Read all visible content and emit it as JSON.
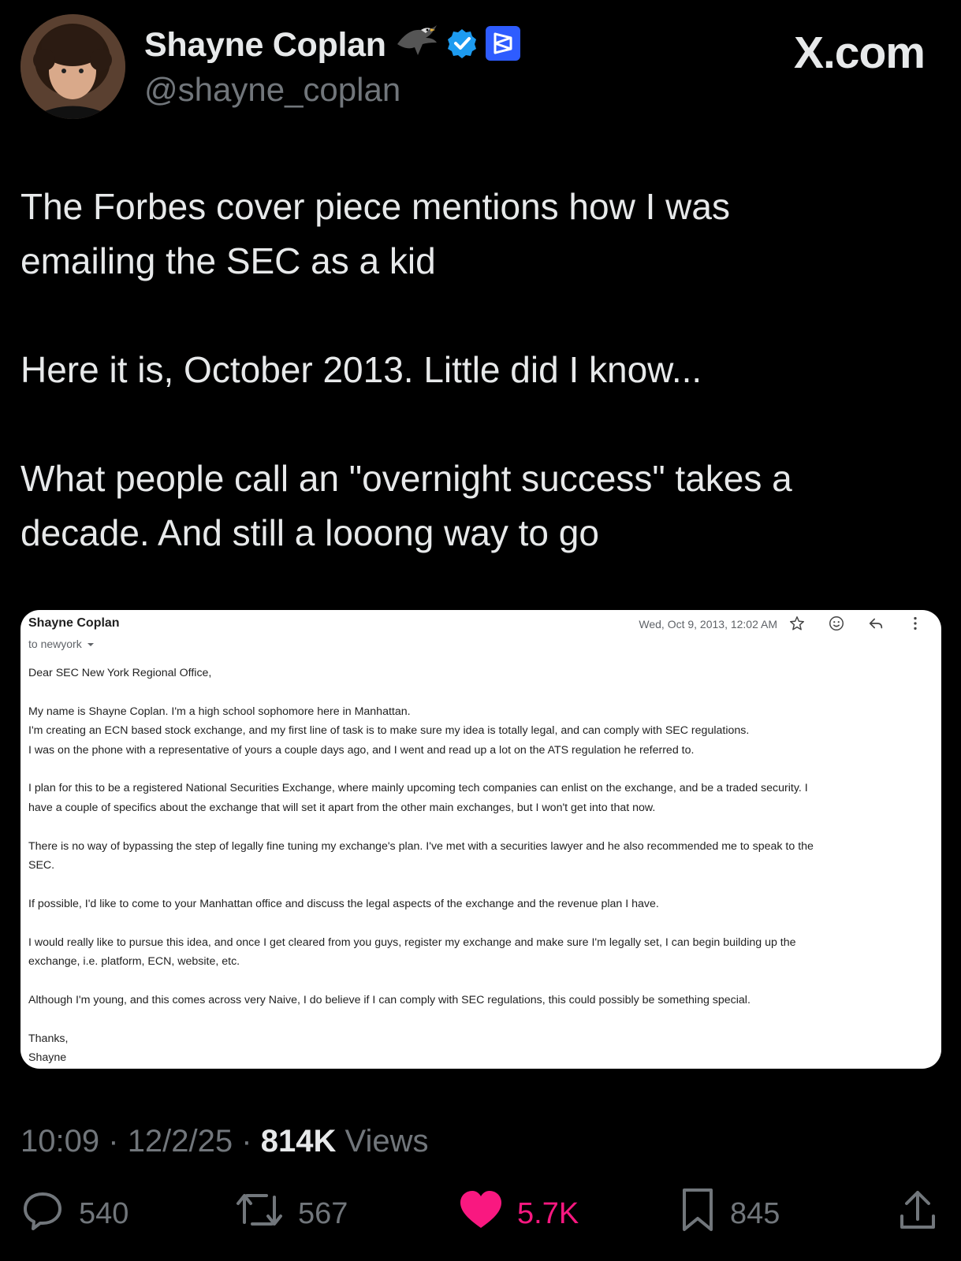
{
  "author": {
    "name": "Shayne Coplan",
    "handle": "@shayne_coplan",
    "badges": [
      "eagle-emoji",
      "verified-badge-icon",
      "polymarket-logo-icon"
    ]
  },
  "brand_watermark": "X.com",
  "tweet": {
    "paragraphs": [
      "The Forbes cover piece mentions how I was\nemailing the SEC as a kid",
      "Here it is, October 2013. Little did I know...",
      "What people call an \"overnight success\" takes a\ndecade. And still a looong way to go"
    ]
  },
  "email": {
    "sender": "Shayne Coplan",
    "recipient": "to newyork",
    "date": "Wed, Oct 9, 2013, 12:02 AM",
    "icons": [
      "star-icon",
      "emoji-icon",
      "reply-icon",
      "more-vertical-icon"
    ],
    "body": [
      "Dear SEC New York Regional Office,",
      "My name is Shayne Coplan. I'm a high school sophomore here in Manhattan.\nI'm creating an ECN based stock exchange, and my first line of task is to make sure my idea is totally legal, and can comply with SEC regulations.\nI was on the phone with a representative of yours a couple days ago, and I went and read up a lot on the ATS regulation he referred to.",
      "I plan for this to be a registered National Securities Exchange, where mainly upcoming tech companies can enlist on the exchange, and be a traded security. I\nhave a couple of specifics about the exchange that will set it apart from the other main exchanges, but I won't get into that now.",
      "There is no way of bypassing the step of legally fine tuning my exchange's plan. I've met with a securities lawyer and he also recommended me to speak to the\nSEC.",
      "If possible, I'd like to come to your Manhattan office and discuss the legal aspects of the exchange and the revenue plan I have.",
      "I would really like to pursue this idea, and once I get cleared from you guys, register my exchange and make sure I'm legally set, I can begin building up the\nexchange, i.e. platform, ECN, website, etc.",
      "Although I'm young, and this comes across very Naive, I do believe if I can comply with SEC regulations, this could possibly be something special.",
      "Thanks,\nShayne"
    ]
  },
  "meta": {
    "time": "10:09",
    "separator": "·",
    "date": "12/2/25",
    "views_count": "814K",
    "views_label": "Views"
  },
  "actions": {
    "replies": "540",
    "reposts": "567",
    "likes": "5.7K",
    "bookmarks": "845"
  },
  "colors": {
    "background": "#000000",
    "text": "#e7e9ea",
    "muted": "#71767b",
    "like": "#f91880",
    "verified": "#1d9bf0",
    "polymarket": "#2e5cff"
  }
}
